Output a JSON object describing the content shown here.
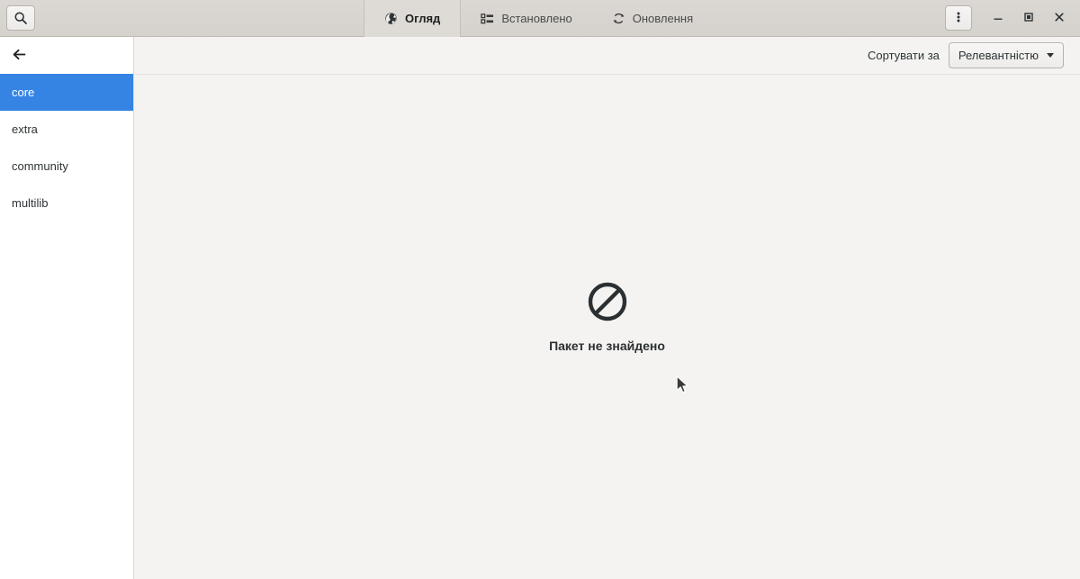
{
  "window": {
    "titlebar": {
      "search_button": {
        "icon": "search-icon",
        "label": ""
      },
      "menu_button": {
        "icon": "menu-dots-icon",
        "label": ""
      },
      "minimize": {
        "icon": "minimize-icon",
        "label": ""
      },
      "maximize": {
        "icon": "maximize-icon",
        "label": ""
      },
      "close": {
        "icon": "close-icon",
        "label": ""
      }
    },
    "tabs": [
      {
        "label": "Огляд",
        "icon": "globe-icon",
        "active": true
      },
      {
        "label": "Встановлено",
        "icon": "list-icon",
        "active": false
      },
      {
        "label": "Оновлення",
        "icon": "refresh-icon",
        "active": false
      }
    ]
  },
  "sidebar": {
    "back_button": {
      "icon": "back-arrow-icon"
    },
    "items": [
      {
        "label": "core",
        "selected": true
      },
      {
        "label": "extra",
        "selected": false
      },
      {
        "label": "community",
        "selected": false
      },
      {
        "label": "multilib",
        "selected": false
      }
    ]
  },
  "toolbar": {
    "sort_label": "Сортувати за",
    "sort_value": "Релевантністю"
  },
  "main": {
    "empty_state": {
      "icon": "no-entry-icon",
      "title": "Пакет не знайдено"
    }
  },
  "colors": {
    "accent": "#3584e4",
    "headerbar": "#d8d4d0",
    "active_tab": "#dedad6",
    "content_bg": "#f4f3f1",
    "sidebar_bg": "#ffffff",
    "text": "#2e3436"
  }
}
